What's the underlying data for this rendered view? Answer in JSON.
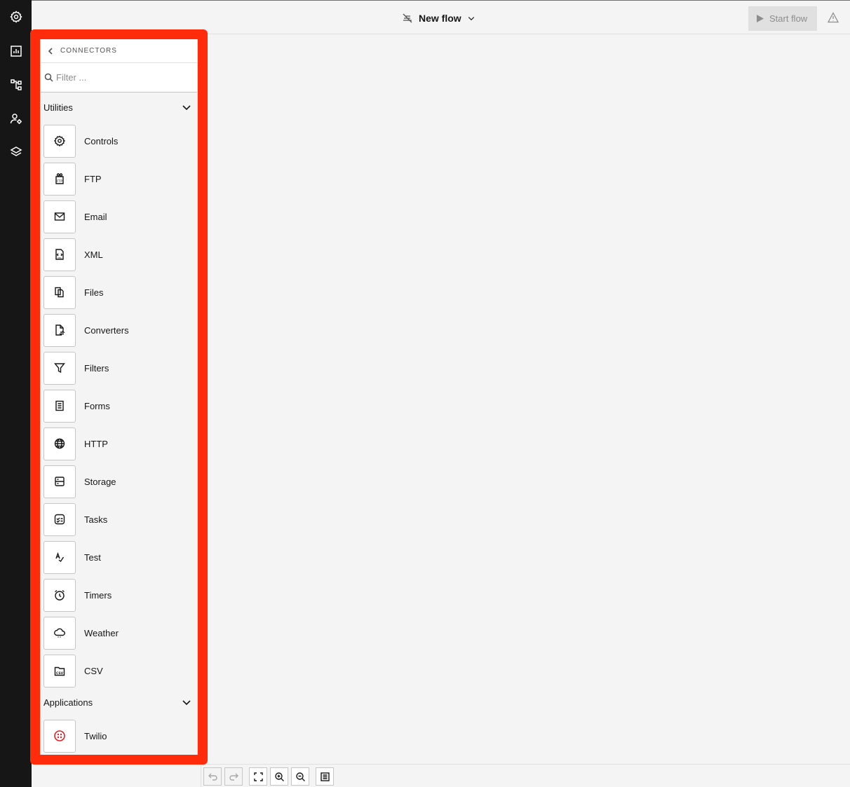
{
  "rail": {
    "items": [
      {
        "icon": "settings-icon"
      },
      {
        "icon": "dashboard-icon"
      },
      {
        "icon": "flows-icon"
      },
      {
        "icon": "user-settings-icon"
      },
      {
        "icon": "layers-icon"
      }
    ]
  },
  "header": {
    "flow_title": "New flow",
    "start_label": "Start flow"
  },
  "panel": {
    "title": "CONNECTORS",
    "search_placeholder": "Filter ...",
    "sections": [
      {
        "label": "Utilities",
        "items": [
          {
            "label": "Controls",
            "icon": "gear-icon"
          },
          {
            "label": "FTP",
            "icon": "ftp-icon"
          },
          {
            "label": "Email",
            "icon": "email-icon"
          },
          {
            "label": "XML",
            "icon": "xml-file-icon"
          },
          {
            "label": "Files",
            "icon": "files-icon"
          },
          {
            "label": "Converters",
            "icon": "convert-icon"
          },
          {
            "label": "Filters",
            "icon": "filter-icon"
          },
          {
            "label": "Forms",
            "icon": "form-icon"
          },
          {
            "label": "HTTP",
            "icon": "globe-icon"
          },
          {
            "label": "Storage",
            "icon": "storage-icon"
          },
          {
            "label": "Tasks",
            "icon": "tasks-icon"
          },
          {
            "label": "Test",
            "icon": "test-icon"
          },
          {
            "label": "Timers",
            "icon": "alarm-icon"
          },
          {
            "label": "Weather",
            "icon": "weather-icon"
          },
          {
            "label": "CSV",
            "icon": "csv-icon"
          }
        ]
      },
      {
        "label": "Applications",
        "items": [
          {
            "label": "Twilio",
            "icon": "twilio-icon"
          }
        ]
      }
    ]
  },
  "colors": {
    "highlight": "#ff2b0a",
    "rail": "#161616",
    "twilio": "#e31e26"
  }
}
